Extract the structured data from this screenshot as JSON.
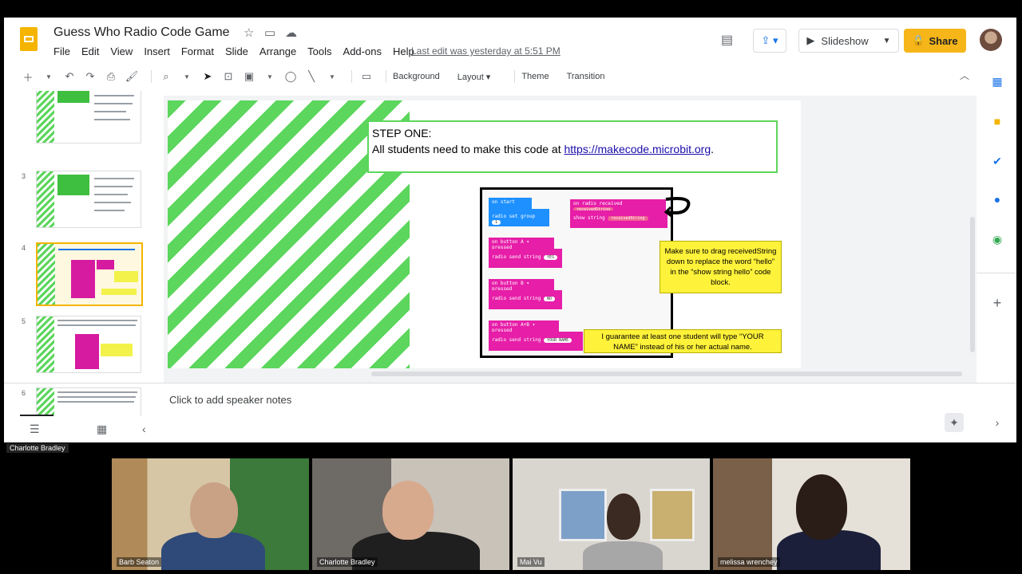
{
  "app": {
    "title": "Guess Who Radio Code Game",
    "menu": [
      "File",
      "Edit",
      "View",
      "Insert",
      "Format",
      "Slide",
      "Arrange",
      "Tools",
      "Add-ons",
      "Help"
    ],
    "last_edit": "Last edit was yesterday at 5:51 PM",
    "slideshow_label": "Slideshow",
    "share_label": "Share",
    "colors": {
      "accent": "#f6b61a",
      "stripe": "#5cd65c",
      "pink": "#e61ea8",
      "blue": "#1e90ff",
      "note": "#fff23a"
    }
  },
  "toolbar": {
    "background_label": "Background",
    "layout_label": "Layout",
    "theme_label": "Theme",
    "transition_label": "Transition"
  },
  "filmstrip": {
    "slides": [
      {
        "number": "3"
      },
      {
        "number": "4"
      },
      {
        "number": "5"
      },
      {
        "number": "6"
      }
    ],
    "selected": "4"
  },
  "slide": {
    "step_title": "STEP ONE:",
    "step_text": "All students need to make this code at ",
    "step_link": "https://makecode.microbit.org",
    "step_end": ".",
    "code": {
      "on_start": "on start",
      "radio_set_group": "radio set group",
      "group_value": "1",
      "on_radio_received": "on radio received",
      "received_param": "receivedString",
      "show_string": "show string",
      "show_value": "receivedString",
      "on_button_a": "on button  A ▾  pressed",
      "send_string_1": "radio send string",
      "value_1": "YES",
      "on_button_b": "on button  B ▾  pressed",
      "send_string_2": "radio send string",
      "value_2": "NO",
      "on_button_ab": "on button  A+B ▾  pressed",
      "send_string_3": "radio send string",
      "value_3": "YOUR NAME"
    },
    "note_1": "Make sure to drag receivedString down to replace the word “hello” in the “show string hello” code block.",
    "note_2": "I guarantee at least one student will type “YOUR NAME” instead of his or her actual name."
  },
  "notes": {
    "placeholder": "Click to add speaker notes"
  },
  "meeting": {
    "presenter": "Charlotte Bradley",
    "participants": [
      {
        "name": "Barb Seaton"
      },
      {
        "name": "Charlotte Bradley"
      },
      {
        "name": "Mai Vu"
      },
      {
        "name": "melissa wrenchey"
      }
    ]
  }
}
